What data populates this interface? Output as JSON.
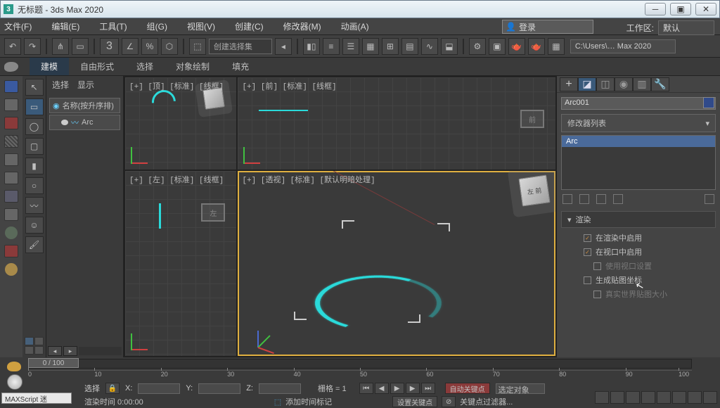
{
  "app": {
    "title": "无标题 - 3ds Max 2020",
    "icon_label": "3"
  },
  "menus": [
    "文件(F)",
    "编辑(E)",
    "工具(T)",
    "组(G)",
    "视图(V)",
    "创建(C)",
    "修改器(M)",
    "动画(A)"
  ],
  "login": {
    "label": "登录",
    "icon_glyph": "👤"
  },
  "workspace": {
    "label": "工作区:",
    "value": "默认"
  },
  "toolbar": {
    "sel_set": "创建选择集",
    "path": "C:\\Users\\… Max 2020"
  },
  "ribbon_tabs": [
    "建模",
    "自由形式",
    "选择",
    "对象绘制",
    "填充"
  ],
  "scene": {
    "tab_select": "选择",
    "tab_display": "显示",
    "sort_label": "名称(按升序排)",
    "item": "Arc"
  },
  "viewports": {
    "top": "[+] [顶] [标准] [线框]",
    "front": "[+] [前] [标准] [线框]",
    "left": "[+] [左] [标准] [线框]",
    "persp": "[+] [透视] [标准] [默认明暗处理]",
    "cube_front": "前",
    "cube_left": "左"
  },
  "right": {
    "object_name": "Arc001",
    "modifier_list": "修改器列表",
    "stack_item": "Arc",
    "rollout_title": "渲染",
    "opt_render": "在渲染中启用",
    "opt_viewport": "在视口中启用",
    "opt_vp_settings": "使用视口设置",
    "opt_mapping": "生成贴图坐标",
    "opt_realworld": "真实世界贴图大小"
  },
  "timeline": {
    "pos": "0 / 100",
    "ticks": [
      "0",
      "10",
      "20",
      "30",
      "40",
      "50",
      "60",
      "70",
      "80",
      "90",
      "100"
    ]
  },
  "status": {
    "sel_label": "选择",
    "x": "X:",
    "y": "Y:",
    "z": "Z:",
    "grid": "栅格 = 1",
    "auto_key": "自动关键点",
    "sel_obj": "选定对象",
    "set_key": "设置关键点",
    "key_filter": "关键点过滤器...",
    "render_time": "渲染时间  0:00:00",
    "add_time_tag": "添加时间标记",
    "maxscript": "MAXScript 迷"
  }
}
